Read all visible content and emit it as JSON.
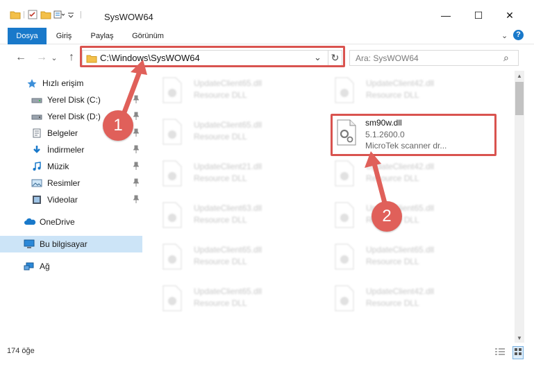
{
  "window": {
    "title": "SysWOW64",
    "minimize_glyph": "—",
    "maximize_glyph": "☐",
    "close_glyph": "✕"
  },
  "ribbon": {
    "tabs": [
      "Dosya",
      "Giriş",
      "Paylaş",
      "Görünüm"
    ],
    "expand_glyph": "⌄",
    "help_glyph": "?"
  },
  "navigation": {
    "back_glyph": "←",
    "forward_glyph": "→",
    "history_glyph": "⌄",
    "up_glyph": "↑",
    "address_path": "C:\\Windows\\SysWOW64",
    "address_dropdown_glyph": "⌄",
    "refresh_glyph": "↻",
    "search_placeholder": "Ara: SysWOW64",
    "search_glyph": "⌕"
  },
  "sidebar": {
    "items": [
      {
        "label": "Hızlı erişim",
        "icon": "star-icon"
      },
      {
        "label": "Yerel Disk (C:)",
        "icon": "drive-icon"
      },
      {
        "label": "Yerel Disk (D:)",
        "icon": "drive-icon"
      },
      {
        "label": "Belgeler",
        "icon": "documents-icon"
      },
      {
        "label": "İndirmeler",
        "icon": "download-icon"
      },
      {
        "label": "Müzik",
        "icon": "music-icon"
      },
      {
        "label": "Resimler",
        "icon": "pictures-icon"
      },
      {
        "label": "Videolar",
        "icon": "videos-icon"
      },
      {
        "label": "OneDrive",
        "icon": "cloud-icon"
      },
      {
        "label": "Bu bilgisayar",
        "icon": "computer-icon"
      },
      {
        "label": "Ağ",
        "icon": "network-icon"
      }
    ]
  },
  "files": {
    "column_left": [
      {
        "name": "UpdateClient65.dll",
        "desc": "Resource DLL"
      },
      {
        "name": "UpdateClient65.dll",
        "desc": "Resource DLL"
      },
      {
        "name": "UpdateClient21.dll",
        "desc": "Resource DLL"
      },
      {
        "name": "UpdateClient63.dll",
        "desc": "Resource DLL"
      },
      {
        "name": "UpdateClient65.dll",
        "desc": "Resource DLL"
      },
      {
        "name": "UpdateClient65.dll",
        "desc": "Resource DLL"
      }
    ],
    "column_right": [
      {
        "name": "UpdateClient42.dll",
        "desc": "Resource DLL"
      },
      {
        "name": "UpdateClient42.dll",
        "desc": "Resource DLL"
      },
      {
        "name": "UpdateClient65.dll",
        "desc": "Resource DLL"
      },
      {
        "name": "UpdateClient65.dll",
        "desc": "Resource DLL"
      },
      {
        "name": "UpdateClient42.dll",
        "desc": "Resource DLL"
      }
    ],
    "highlighted": {
      "name": "sm90w.dll",
      "version": "5.1.2600.0",
      "description": "MicroTek scanner dr..."
    }
  },
  "annotations": {
    "step1": "1",
    "step2": "2",
    "color": "#e0605a"
  },
  "status": {
    "item_count": "174 öğe"
  }
}
